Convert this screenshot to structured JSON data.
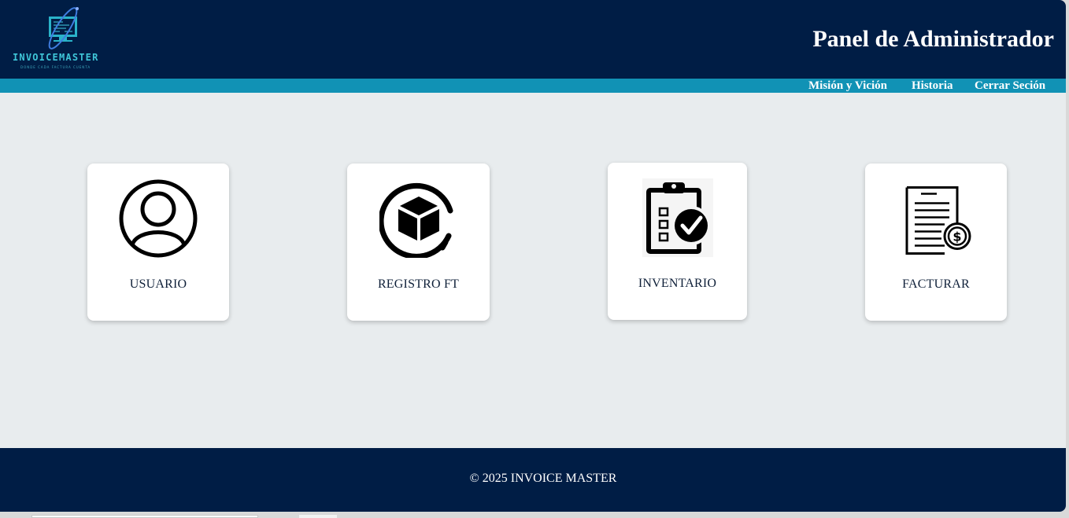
{
  "header": {
    "logo_text": "INVOICEMASTER",
    "logo_tagline": "DONDE CADA FACTURA CUENTA",
    "title": "Panel de Administrador"
  },
  "nav": {
    "items": [
      {
        "label": "Misión y Vición"
      },
      {
        "label": "Historia"
      },
      {
        "label": "Cerrar Seción"
      }
    ]
  },
  "cards": [
    {
      "label": "USUARIO",
      "icon": "user-icon"
    },
    {
      "label": "REGISTRO FT",
      "icon": "box-icon"
    },
    {
      "label": "INVENTARIO",
      "icon": "clipboard-check-icon"
    },
    {
      "label": "FACTURAR",
      "icon": "invoice-dollar-icon"
    }
  ],
  "footer": {
    "text": "© 2025 INVOICE MASTER"
  },
  "colors": {
    "header_bg": "#001d45",
    "nav_bg": "#1192b5",
    "page_bg": "#e8ecee",
    "accent": "#3fc6d8"
  }
}
